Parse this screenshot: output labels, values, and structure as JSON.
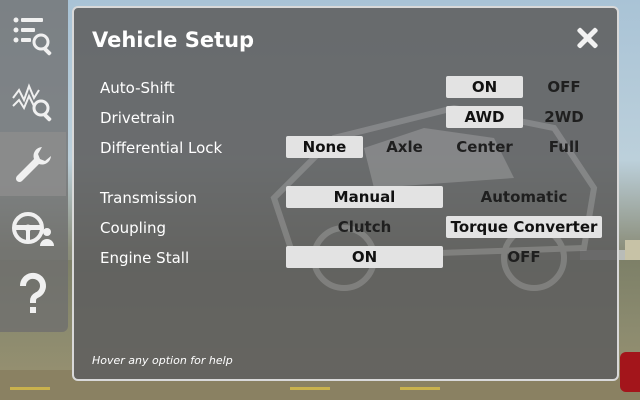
{
  "sidebar": {
    "items": [
      {
        "icon": "list-search-icon",
        "active": false
      },
      {
        "icon": "graph-search-icon",
        "active": false
      },
      {
        "icon": "wrench-icon",
        "active": true
      },
      {
        "icon": "steering-wheel-user-icon",
        "active": false
      },
      {
        "icon": "question-icon",
        "active": false
      }
    ]
  },
  "panel": {
    "title": "Vehicle Setup",
    "help": "Hover any option for help"
  },
  "settings": {
    "autoshift": {
      "label": "Auto-Shift",
      "options": [
        "ON",
        "OFF"
      ],
      "selected": "ON"
    },
    "drivetrain": {
      "label": "Drivetrain",
      "options": [
        "AWD",
        "2WD"
      ],
      "selected": "AWD"
    },
    "difflock": {
      "label": "Differential Lock",
      "options": [
        "None",
        "Axle",
        "Center",
        "Full"
      ],
      "selected": "None"
    },
    "transmission": {
      "label": "Transmission",
      "options": [
        "Manual",
        "Automatic"
      ],
      "selected": "Manual"
    },
    "coupling": {
      "label": "Coupling",
      "options": [
        "Clutch",
        "Torque Converter"
      ],
      "selected": "Torque Converter"
    },
    "stall": {
      "label": "Engine Stall",
      "options": [
        "ON",
        "OFF"
      ],
      "selected": "ON"
    }
  },
  "colors": {
    "selected_bg": "#e3e3e3",
    "panel_bg": "#5f5f5f",
    "panel_border": "#d9d9d9"
  }
}
